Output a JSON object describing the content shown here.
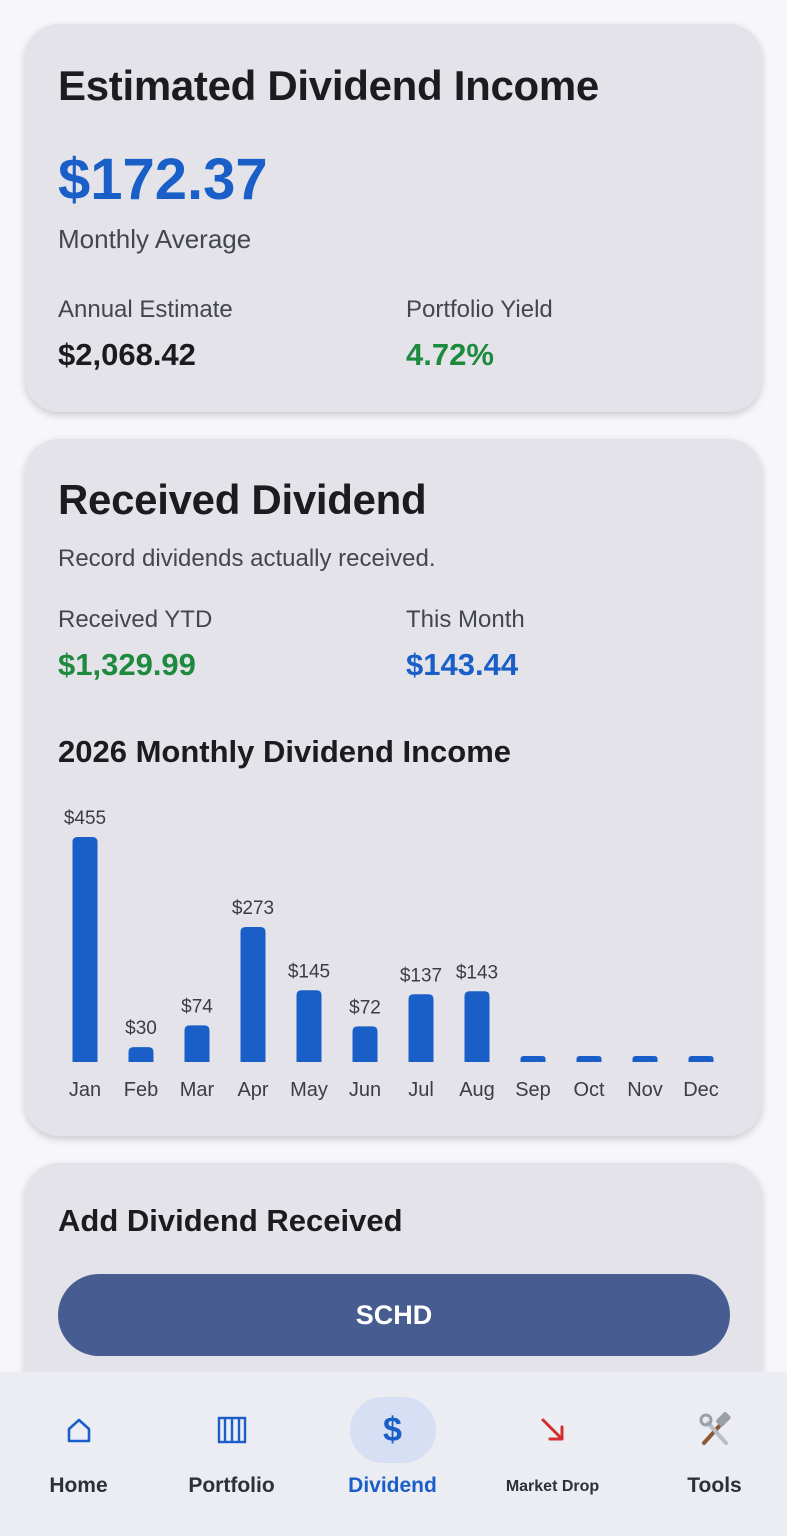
{
  "estimate_card": {
    "title": "Estimated Dividend Income",
    "monthly_amount": "$172.37",
    "monthly_label": "Monthly Average",
    "annual_label": "Annual Estimate",
    "annual_value": "$2,068.42",
    "yield_label": "Portfolio Yield",
    "yield_value": "4.72%"
  },
  "received_card": {
    "title": "Received Dividend",
    "subtitle": "Record dividends actually received.",
    "ytd_label": "Received YTD",
    "ytd_value": "$1,329.99",
    "month_label": "This Month",
    "month_value": "$143.44",
    "chart_title": "2026 Monthly Dividend Income"
  },
  "chart_data": {
    "type": "bar",
    "title": "2026 Monthly Dividend Income",
    "categories": [
      "Jan",
      "Feb",
      "Mar",
      "Apr",
      "May",
      "Jun",
      "Jul",
      "Aug",
      "Sep",
      "Oct",
      "Nov",
      "Dec"
    ],
    "values": [
      455,
      30,
      74,
      273,
      145,
      72,
      137,
      143,
      0,
      0,
      0,
      0
    ],
    "data_labels": [
      "$455",
      "$30",
      "$74",
      "$273",
      "$145",
      "$72",
      "$137",
      "$143",
      "",
      "",
      "",
      ""
    ],
    "ylim": [
      0,
      455
    ],
    "grid": false,
    "color": "#1a5fc8"
  },
  "add_card": {
    "title": "Add Dividend Received",
    "ticker_button": "SCHD"
  },
  "nav": {
    "items": [
      {
        "label": "Home",
        "icon": "home-icon"
      },
      {
        "label": "Portfolio",
        "icon": "portfolio-icon"
      },
      {
        "label": "Dividend",
        "icon": "dollar-icon"
      },
      {
        "label": "Market Drop",
        "icon": "trend-down-arrow-icon"
      },
      {
        "label": "Tools",
        "icon": "tools-icon"
      }
    ],
    "active": "Dividend"
  },
  "colors": {
    "accent_blue": "#1a5fc8",
    "positive_green": "#1d8a3e",
    "button_fill": "#475c90",
    "card_bg": "#e3e3e9"
  }
}
